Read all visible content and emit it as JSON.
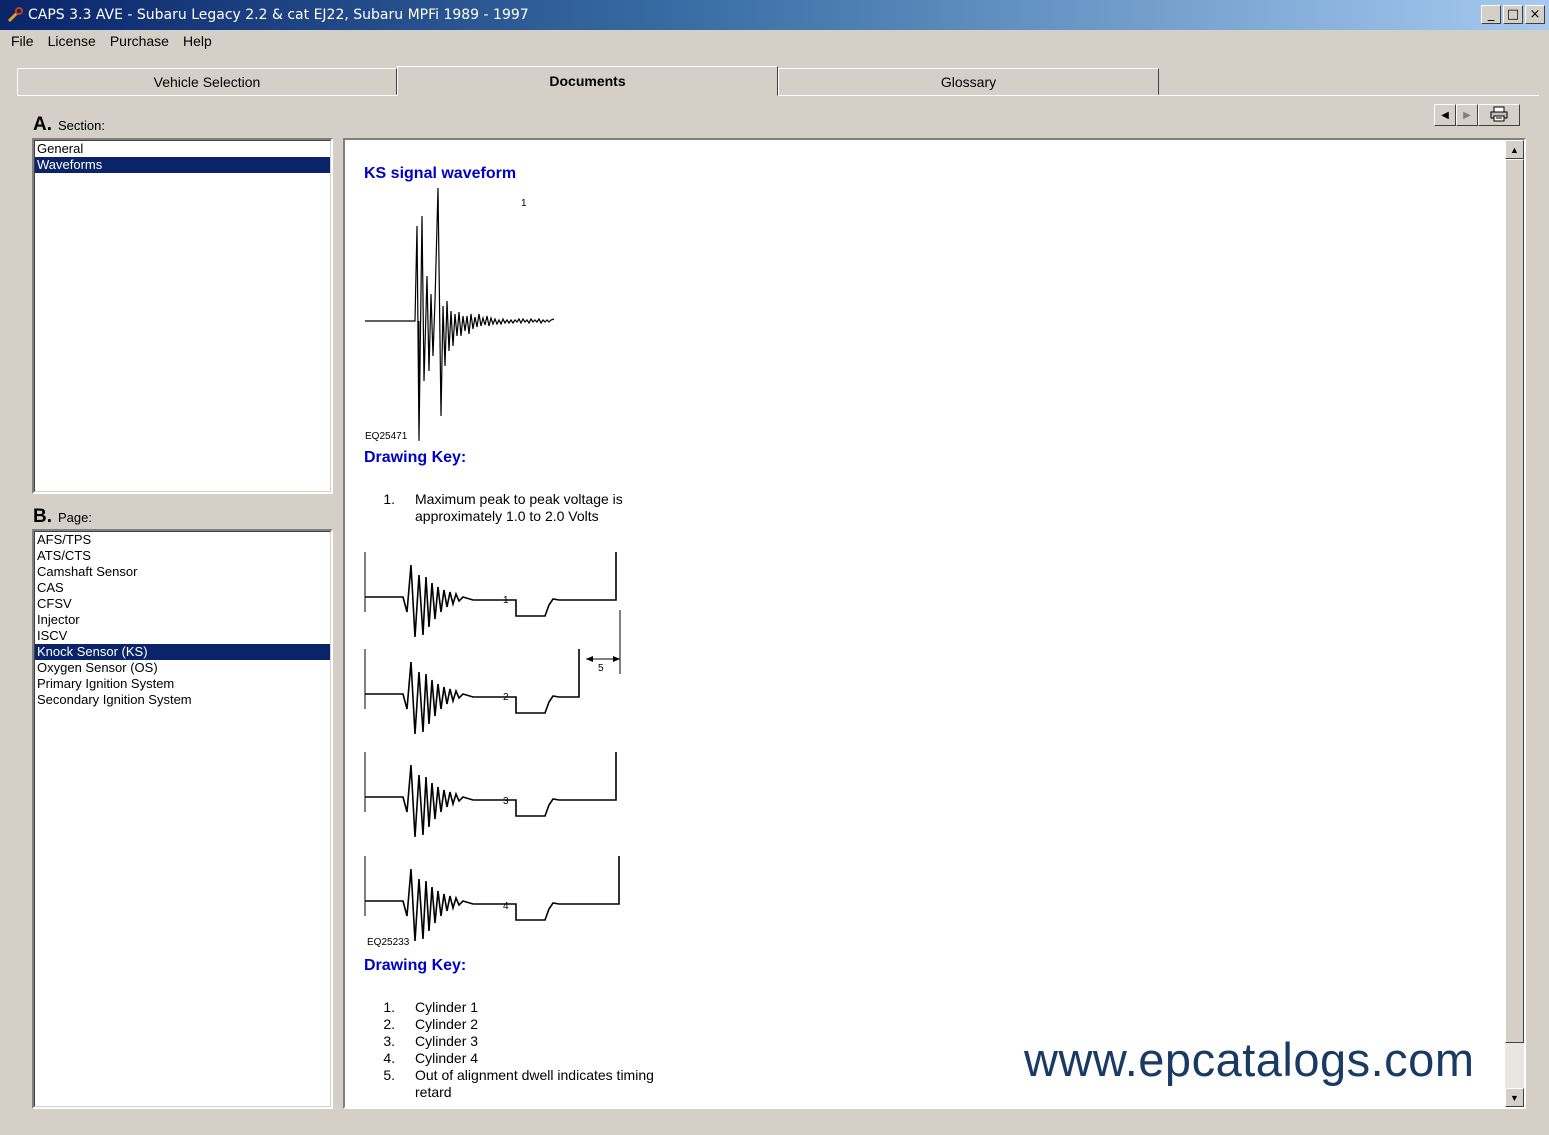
{
  "window": {
    "title": "CAPS 3.3 AVE - Subaru Legacy 2.2 & cat EJ22, Subaru MPFi 1989 - 1997",
    "icon": "wrench-app-icon",
    "buttons": {
      "minimize": "_",
      "maximize": "□",
      "close": "×"
    }
  },
  "menu": [
    "File",
    "License",
    "Purchase",
    "Help"
  ],
  "tabs": [
    {
      "label": "Vehicle Selection",
      "active": false
    },
    {
      "label": "Documents",
      "active": true
    },
    {
      "label": "Glossary",
      "active": false
    }
  ],
  "section": {
    "letter": "A.",
    "label": "Section:",
    "items": [
      {
        "label": "General",
        "selected": false
      },
      {
        "label": "Waveforms",
        "selected": true
      }
    ]
  },
  "page": {
    "letter": "B.",
    "label": "Page:",
    "items": [
      {
        "label": "AFS/TPS",
        "selected": false
      },
      {
        "label": "ATS/CTS",
        "selected": false
      },
      {
        "label": "Camshaft Sensor",
        "selected": false
      },
      {
        "label": "CAS",
        "selected": false
      },
      {
        "label": "CFSV",
        "selected": false
      },
      {
        "label": "Injector",
        "selected": false
      },
      {
        "label": "ISCV",
        "selected": false
      },
      {
        "label": "Knock Sensor (KS)",
        "selected": true
      },
      {
        "label": "Oxygen Sensor (OS)",
        "selected": false
      },
      {
        "label": "Primary Ignition System",
        "selected": false
      },
      {
        "label": "Secondary Ignition System",
        "selected": false
      }
    ]
  },
  "toolbar": {
    "prev_icon": "triangle-left-icon",
    "next_icon": "triangle-right-icon",
    "print_icon": "printer-icon"
  },
  "document": {
    "heading": "KS signal waveform",
    "figure1": {
      "code": "EQ25471",
      "callout": "1"
    },
    "key1_heading": "Drawing Key:",
    "key1": [
      {
        "num": "1.",
        "text": "Maximum peak to peak voltage is approximately 1.0 to 2.0 Volts"
      }
    ],
    "figure2": {
      "code": "EQ25233",
      "callouts": [
        "1",
        "2",
        "3",
        "4",
        "5"
      ]
    },
    "key2_heading": "Drawing Key:",
    "key2": [
      {
        "num": "1.",
        "text": "Cylinder 1"
      },
      {
        "num": "2.",
        "text": "Cylinder 2"
      },
      {
        "num": "3.",
        "text": "Cylinder 3"
      },
      {
        "num": "4.",
        "text": "Cylinder 4"
      },
      {
        "num": "5.",
        "text": "Out of alignment dwell indicates timing retard"
      }
    ]
  },
  "watermark": "www.epcatalogs.com",
  "colors": {
    "title_start": "#0a246a",
    "title_end": "#a6caf0",
    "selection": "#0a246a",
    "heading_text": "#0000cc",
    "face": "#d4d0c8"
  }
}
